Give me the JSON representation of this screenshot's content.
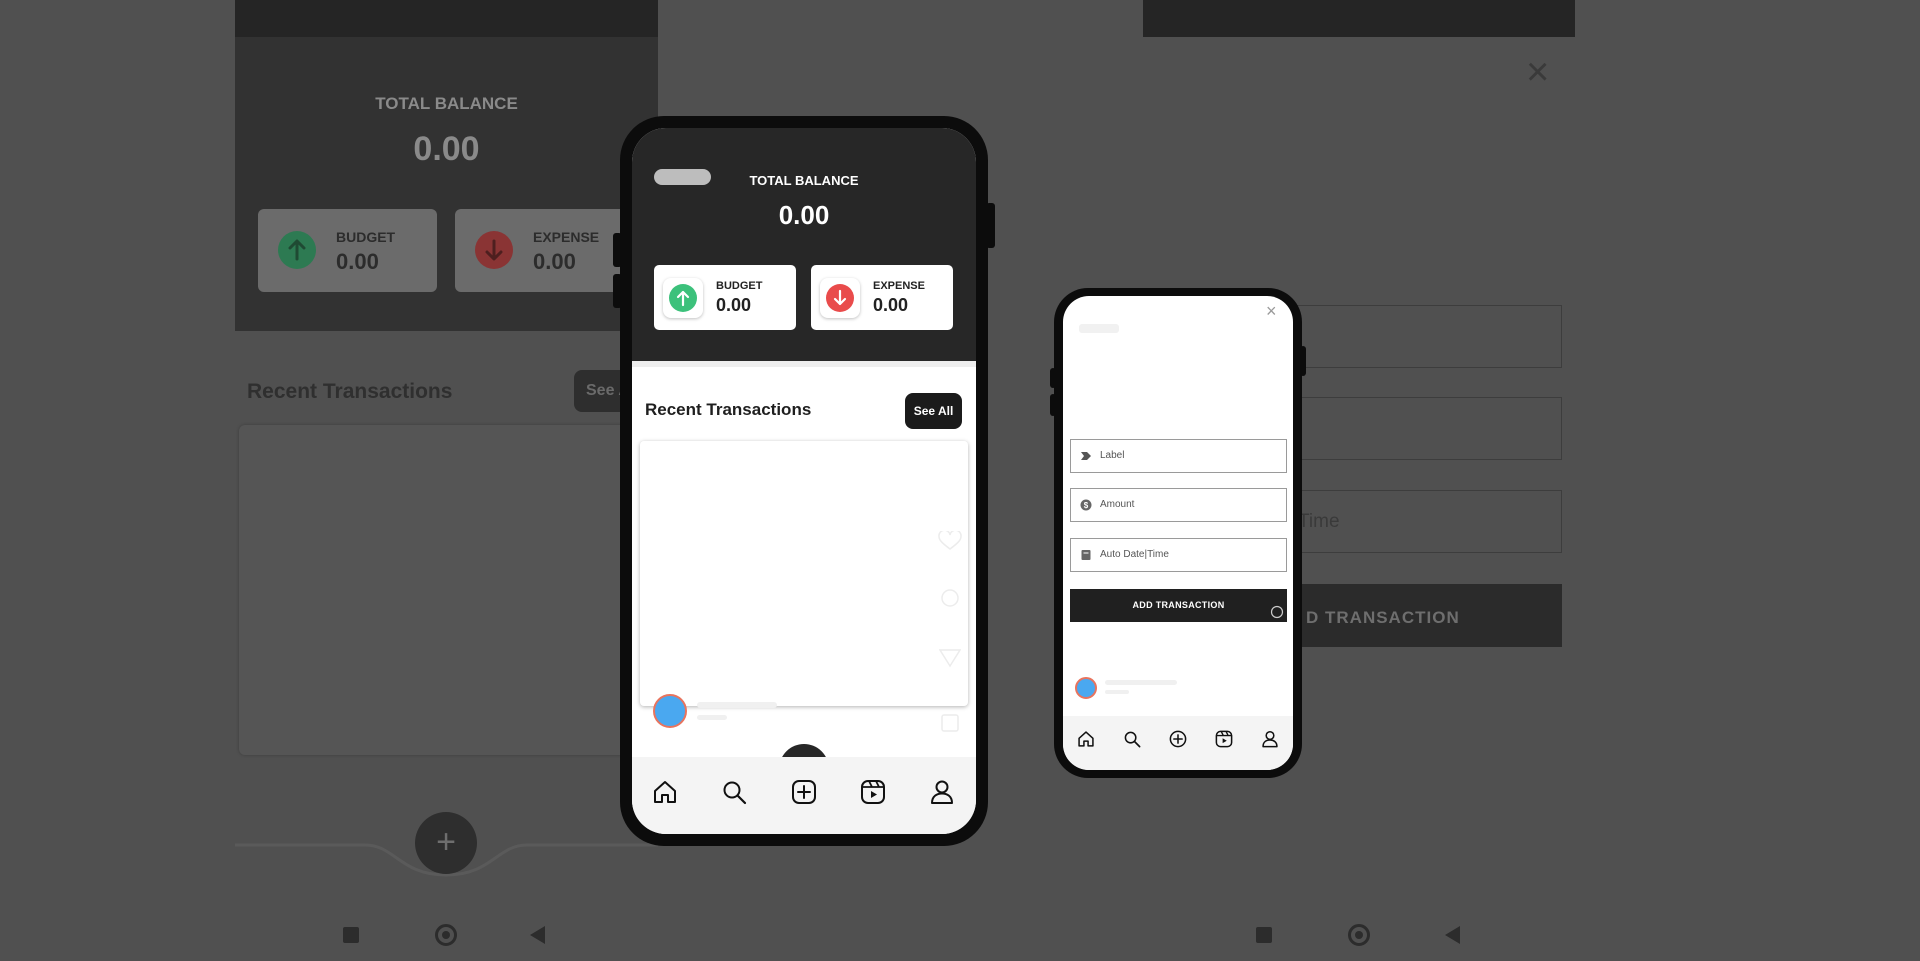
{
  "background_left": {
    "total_label": "TOTAL BALANCE",
    "total_value": "0.00",
    "budget_label": "BUDGET",
    "budget_value": "0.00",
    "expense_label": "EXPENSE",
    "expense_value": "0.00",
    "recent_title": "Recent Transactions",
    "see_all": "See All",
    "fab_symbol": "+"
  },
  "background_right": {
    "close_symbol": "×",
    "datetime_partial": "Time",
    "add_button_partial": "D TRANSACTION"
  },
  "center_phone": {
    "total_label": "TOTAL BALANCE",
    "total_value": "0.00",
    "budget_label": "BUDGET",
    "budget_value": "0.00",
    "expense_label": "EXPENSE",
    "expense_value": "0.00",
    "recent_title": "Recent Transactions",
    "see_all": "See All",
    "nav_items": [
      "home-icon",
      "search-icon",
      "add-icon",
      "reels-icon",
      "profile-icon"
    ]
  },
  "right_phone": {
    "close_symbol": "×",
    "label_placeholder": "Label",
    "amount_placeholder": "Amount",
    "datetime_placeholder": "Auto Date|Time",
    "add_button": "ADD TRANSACTION",
    "nav_items": [
      "home-icon",
      "search-icon",
      "add-icon",
      "reels-icon",
      "profile-icon"
    ]
  },
  "colors": {
    "overlay": "#505050",
    "header_dark": "#272727",
    "budget_green": "#3cc17b",
    "expense_red": "#e94b4b",
    "avatar_blue": "#4aa8f0",
    "avatar_ring": "#e8745e"
  }
}
